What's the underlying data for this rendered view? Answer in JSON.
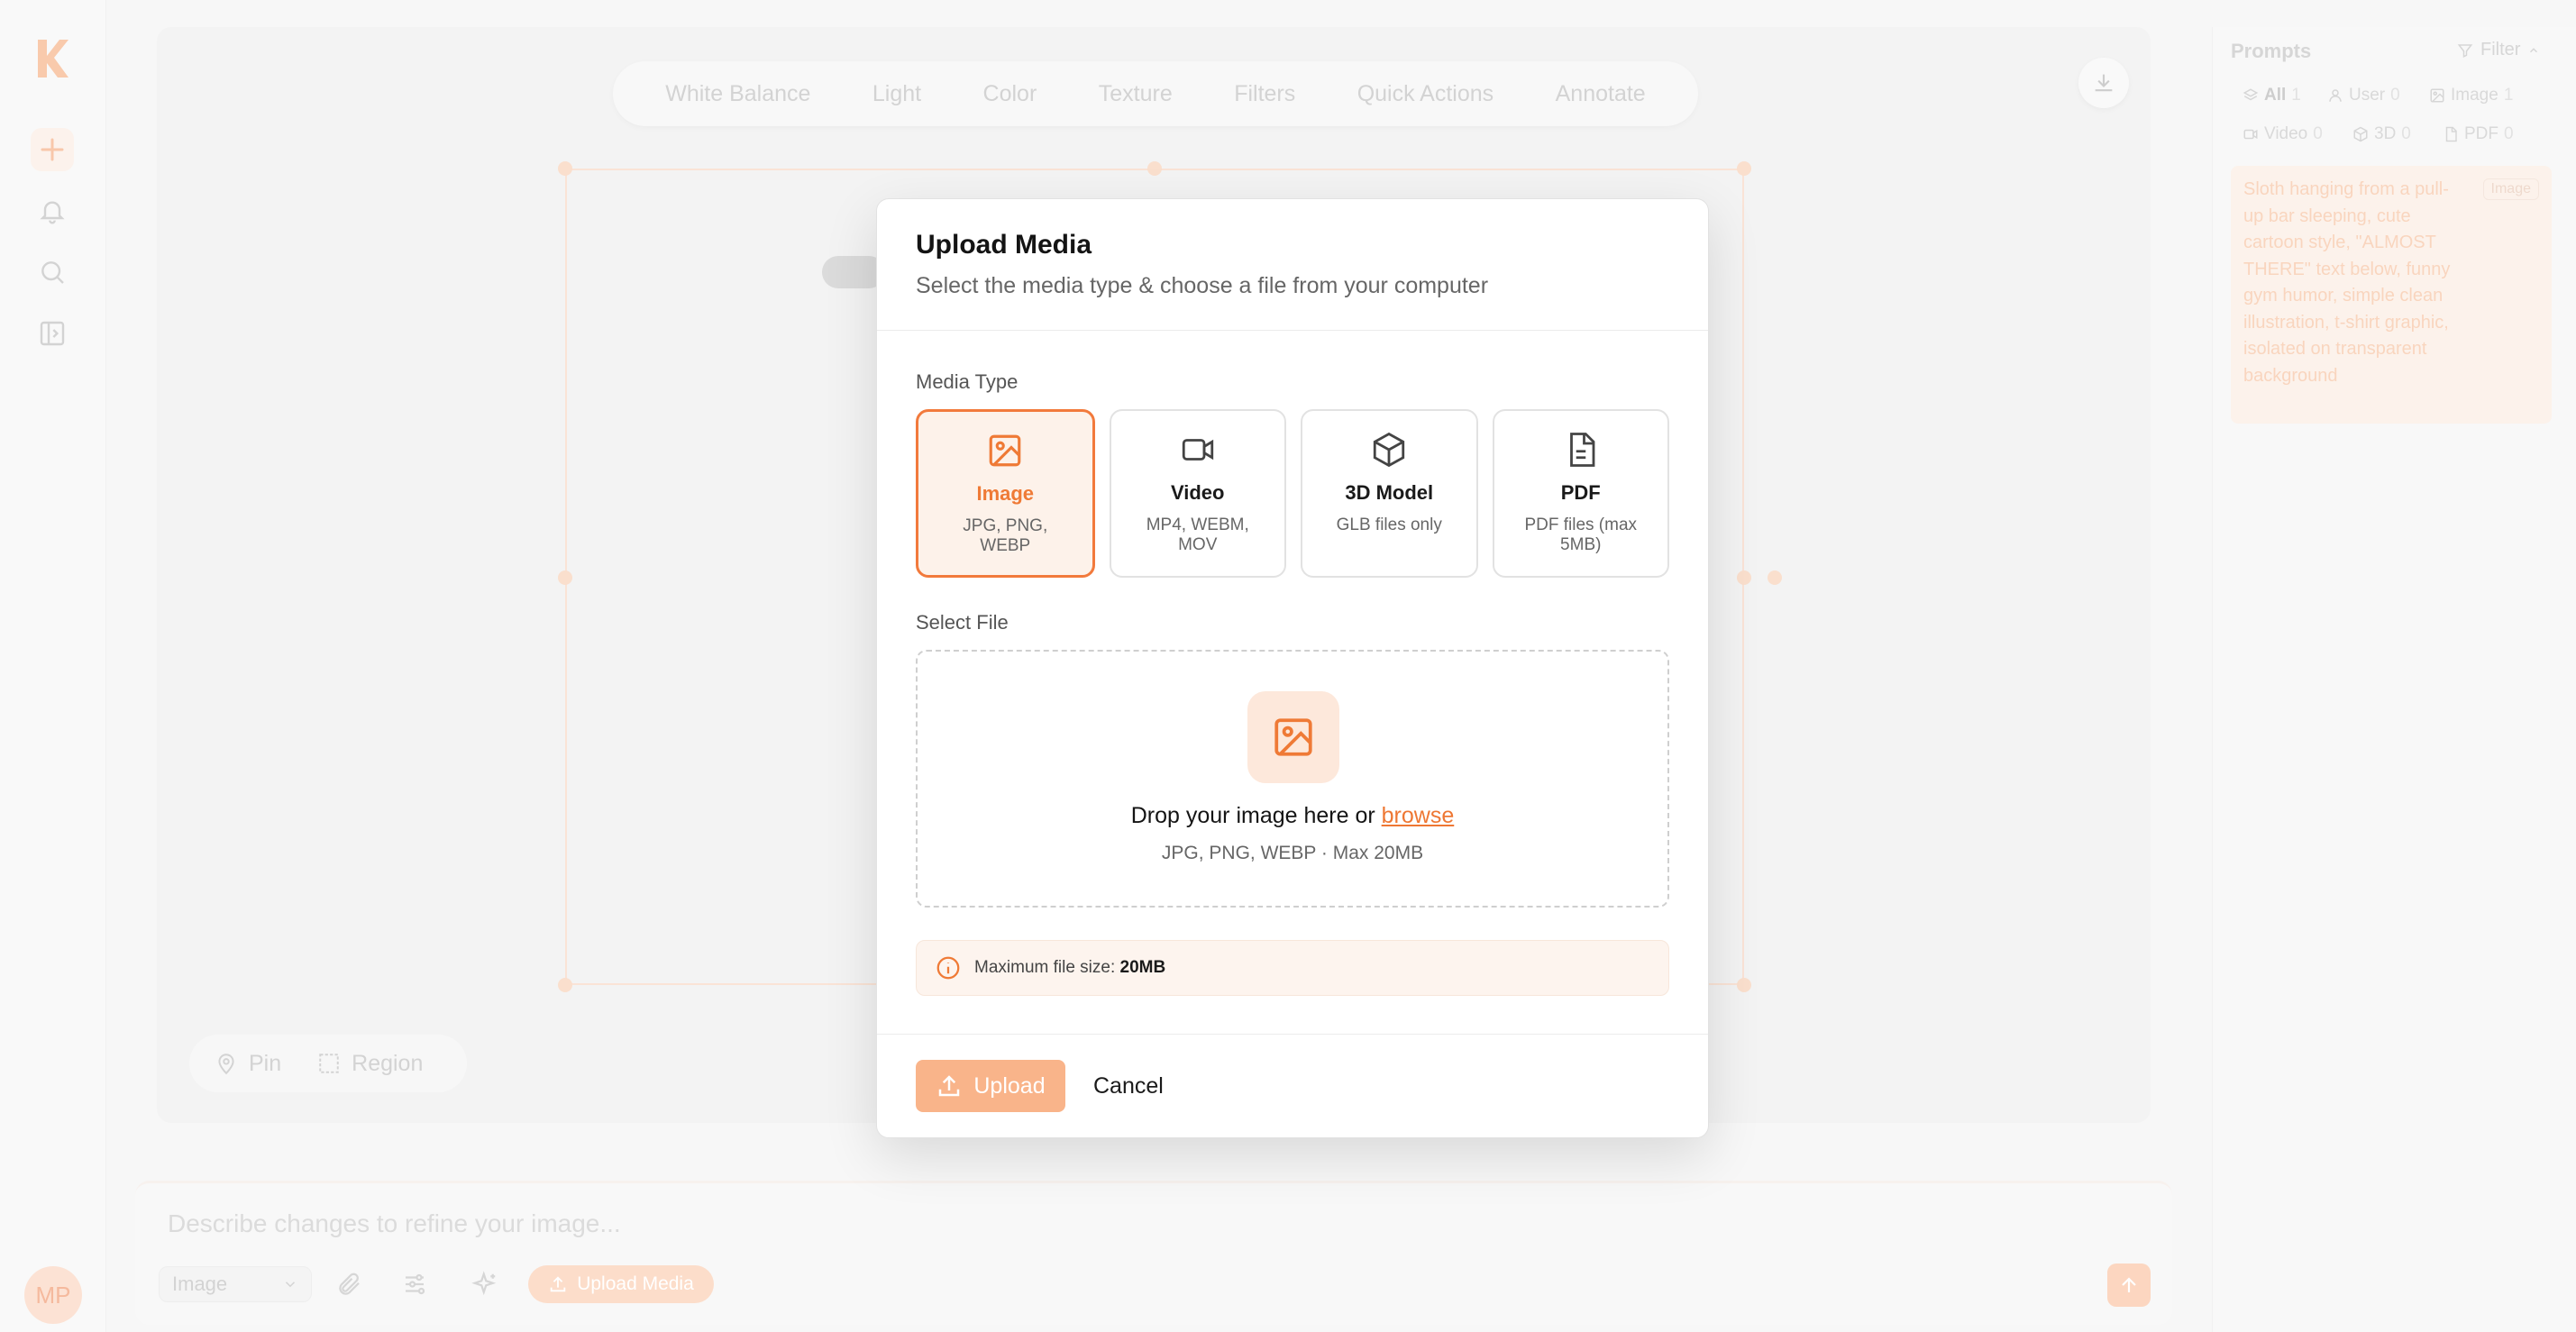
{
  "rail": {
    "avatar_initials": "MP",
    "items": [
      "plus-icon",
      "bell-icon",
      "search-icon",
      "panel-toggle-icon"
    ]
  },
  "toolbar": {
    "tabs": [
      "White Balance",
      "Light",
      "Color",
      "Texture",
      "Filters",
      "Quick Actions",
      "Annotate"
    ]
  },
  "canvas_tools": {
    "pin": "Pin",
    "region": "Region"
  },
  "prompt_bar": {
    "placeholder": "Describe changes to refine your image...",
    "mode": "Image",
    "upload_media": "Upload Media"
  },
  "prompts_panel": {
    "title": "Prompts",
    "filter": "Filter",
    "chips": [
      {
        "label": "All",
        "count": "1"
      },
      {
        "label": "User",
        "count": "0"
      },
      {
        "label": "Image",
        "count": "1"
      },
      {
        "label": "Video",
        "count": "0"
      },
      {
        "label": "3D",
        "count": "0"
      },
      {
        "label": "PDF",
        "count": "0"
      }
    ],
    "card_text": "Sloth hanging from a pull-up bar sleeping, cute cartoon style, \"ALMOST THERE\" text below, funny gym humor, simple clean illustration, t-shirt graphic, isolated on transparent background",
    "card_tag": "Image"
  },
  "modal": {
    "title": "Upload Media",
    "subtitle": "Select the media type & choose a file from your computer",
    "media_type_label": "Media Type",
    "types": [
      {
        "name": "Image",
        "desc": "JPG, PNG, WEBP",
        "icon": "image-icon",
        "selected": true
      },
      {
        "name": "Video",
        "desc": "MP4, WEBM, MOV",
        "icon": "video-icon",
        "selected": false
      },
      {
        "name": "3D Model",
        "desc": "GLB files only",
        "icon": "cube-icon",
        "selected": false
      },
      {
        "name": "PDF",
        "desc": "PDF files (max 5MB)",
        "icon": "document-icon",
        "selected": false
      }
    ],
    "select_file_label": "Select File",
    "drop_text": "Drop your image here or",
    "browse": "browse",
    "drop_hint": "JPG, PNG, WEBP · Max 20MB",
    "info_label": "Maximum file size:",
    "info_value": "20MB",
    "upload": "Upload",
    "cancel": "Cancel"
  },
  "colors": {
    "accent": "#ef7a36",
    "accent_light": "#fdf2ea",
    "upload_button": "#f9b48a"
  }
}
